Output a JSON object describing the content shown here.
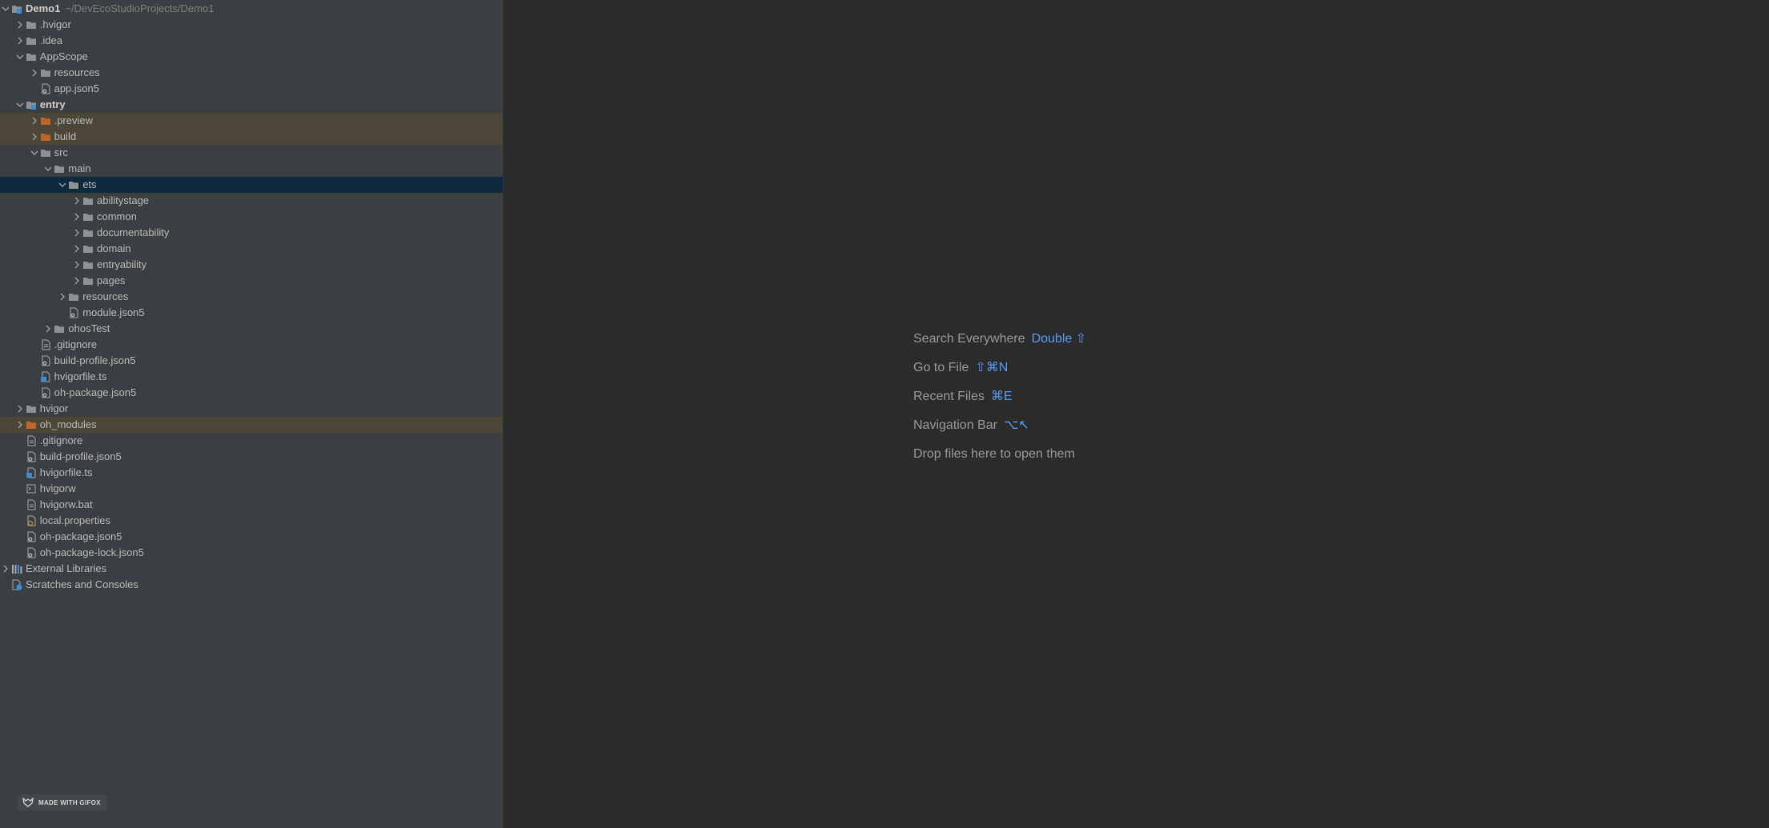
{
  "project": {
    "name": "Demo1",
    "path": "~/DevEcoStudioProjects/Demo1"
  },
  "tree": [
    {
      "label": "Demo1",
      "extra": "~/DevEcoStudioProjects/Demo1",
      "depth": 0,
      "arrow": "down",
      "icon": "module-icon",
      "bold": true
    },
    {
      "label": ".hvigor",
      "depth": 1,
      "arrow": "right",
      "icon": "folder-icon"
    },
    {
      "label": ".idea",
      "depth": 1,
      "arrow": "right",
      "icon": "folder-icon"
    },
    {
      "label": "AppScope",
      "depth": 1,
      "arrow": "down",
      "icon": "folder-icon"
    },
    {
      "label": "resources",
      "depth": 2,
      "arrow": "right",
      "icon": "folder-icon"
    },
    {
      "label": "app.json5",
      "depth": 2,
      "arrow": "none",
      "icon": "json-file-icon"
    },
    {
      "label": "entry",
      "depth": 1,
      "arrow": "down",
      "icon": "module-icon",
      "bold": true
    },
    {
      "label": ".preview",
      "depth": 2,
      "arrow": "right",
      "icon": "excluded-folder-icon",
      "excluded": true
    },
    {
      "label": "build",
      "depth": 2,
      "arrow": "right",
      "icon": "excluded-folder-icon",
      "excluded": true
    },
    {
      "label": "src",
      "depth": 2,
      "arrow": "down",
      "icon": "folder-icon"
    },
    {
      "label": "main",
      "depth": 3,
      "arrow": "down",
      "icon": "folder-icon"
    },
    {
      "label": "ets",
      "depth": 4,
      "arrow": "down",
      "icon": "folder-icon",
      "selected": true
    },
    {
      "label": "abilitystage",
      "depth": 5,
      "arrow": "right",
      "icon": "folder-icon"
    },
    {
      "label": "common",
      "depth": 5,
      "arrow": "right",
      "icon": "folder-icon"
    },
    {
      "label": "documentability",
      "depth": 5,
      "arrow": "right",
      "icon": "folder-icon"
    },
    {
      "label": "domain",
      "depth": 5,
      "arrow": "right",
      "icon": "folder-icon"
    },
    {
      "label": "entryability",
      "depth": 5,
      "arrow": "right",
      "icon": "folder-icon"
    },
    {
      "label": "pages",
      "depth": 5,
      "arrow": "right",
      "icon": "folder-icon"
    },
    {
      "label": "resources",
      "depth": 4,
      "arrow": "right",
      "icon": "folder-icon"
    },
    {
      "label": "module.json5",
      "depth": 4,
      "arrow": "none",
      "icon": "json-file-icon"
    },
    {
      "label": "ohosTest",
      "depth": 3,
      "arrow": "right",
      "icon": "folder-icon"
    },
    {
      "label": ".gitignore",
      "depth": 2,
      "arrow": "none",
      "icon": "text-file-icon"
    },
    {
      "label": "build-profile.json5",
      "depth": 2,
      "arrow": "none",
      "icon": "json-file-icon"
    },
    {
      "label": "hvigorfile.ts",
      "depth": 2,
      "arrow": "none",
      "icon": "ts-file-icon"
    },
    {
      "label": "oh-package.json5",
      "depth": 2,
      "arrow": "none",
      "icon": "json-file-icon"
    },
    {
      "label": "hvigor",
      "depth": 1,
      "arrow": "right",
      "icon": "folder-icon"
    },
    {
      "label": "oh_modules",
      "depth": 1,
      "arrow": "right",
      "icon": "excluded-folder-icon",
      "excluded": true
    },
    {
      "label": ".gitignore",
      "depth": 1,
      "arrow": "none",
      "icon": "text-file-icon"
    },
    {
      "label": "build-profile.json5",
      "depth": 1,
      "arrow": "none",
      "icon": "json-file-icon"
    },
    {
      "label": "hvigorfile.ts",
      "depth": 1,
      "arrow": "none",
      "icon": "ts-file-icon"
    },
    {
      "label": "hvigorw",
      "depth": 1,
      "arrow": "none",
      "icon": "script-file-icon"
    },
    {
      "label": "hvigorw.bat",
      "depth": 1,
      "arrow": "none",
      "icon": "text-file-icon"
    },
    {
      "label": "local.properties",
      "depth": 1,
      "arrow": "none",
      "icon": "properties-file-icon"
    },
    {
      "label": "oh-package.json5",
      "depth": 1,
      "arrow": "none",
      "icon": "json-file-icon"
    },
    {
      "label": "oh-package-lock.json5",
      "depth": 1,
      "arrow": "none",
      "icon": "json-file-icon"
    },
    {
      "label": "External Libraries",
      "depth": 0,
      "arrow": "right",
      "icon": "libraries-icon"
    },
    {
      "label": "Scratches and Consoles",
      "depth": 0,
      "arrow": "none",
      "icon": "scratches-icon"
    }
  ],
  "empty_state": [
    {
      "label": "Search Everywhere",
      "shortcut": "Double ⇧"
    },
    {
      "label": "Go to File",
      "shortcut": "⇧⌘N"
    },
    {
      "label": "Recent Files",
      "shortcut": "⌘E"
    },
    {
      "label": "Navigation Bar",
      "shortcut": "⌥↖"
    },
    {
      "label": "Drop files here to open them",
      "shortcut": ""
    }
  ],
  "watermark": {
    "text": "MADE WITH GIFOX"
  },
  "colors": {
    "sidebar_bg": "#3c3f41",
    "editor_bg": "#2b2b2b",
    "selected_row": "#0d293e",
    "excluded_row": "#4b4637",
    "shortcut": "#589df6",
    "excluded_folder": "#c2652b"
  }
}
